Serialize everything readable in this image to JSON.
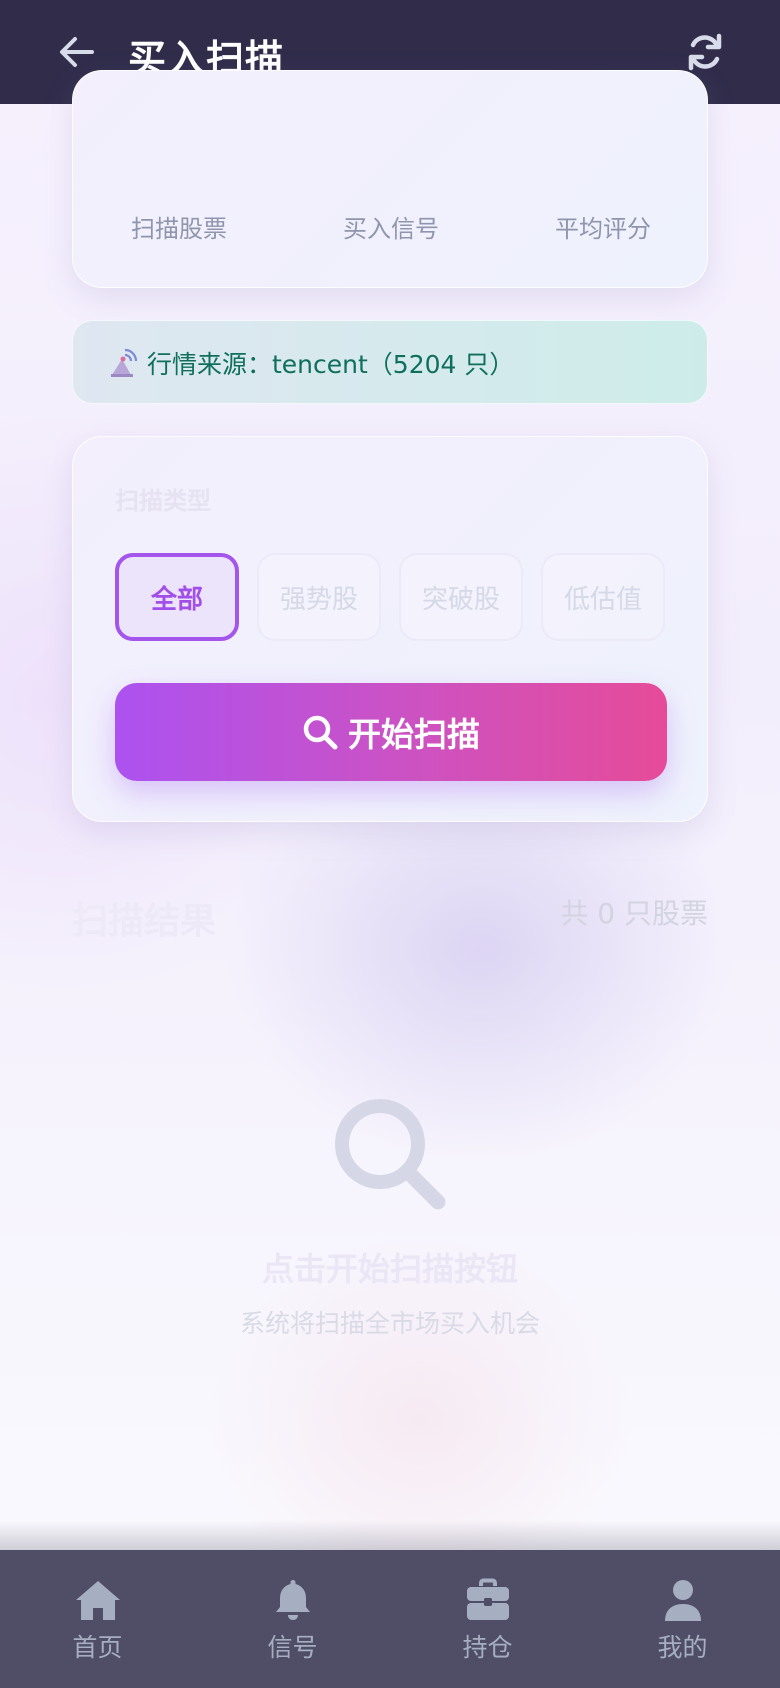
{
  "header": {
    "title": "买入扫描",
    "back_icon": "arrow-left-icon",
    "refresh_icon": "refresh-icon"
  },
  "stats": {
    "labels": [
      "扫描股票",
      "买入信号",
      "平均评分"
    ]
  },
  "source": {
    "icon": "antenna-icon",
    "text": "行情来源：tencent（5204 只）"
  },
  "scan": {
    "section_label": "扫描类型",
    "filters": [
      "全部",
      "强势股",
      "突破股",
      "低估值"
    ],
    "active_filter": "全部",
    "start_button": "开始扫描"
  },
  "results": {
    "title": "扫描结果",
    "count": "共 0 只股票",
    "empty_title": "点击开始扫描按钮",
    "empty_sub": "系统将扫描全市场买入机会"
  },
  "nav": {
    "items": [
      {
        "label": "首页",
        "icon": "home-icon"
      },
      {
        "label": "信号",
        "icon": "bell-icon"
      },
      {
        "label": "持仓",
        "icon": "briefcase-icon"
      },
      {
        "label": "我的",
        "icon": "user-icon"
      }
    ]
  },
  "colors": {
    "header_bg": "#302c4a",
    "accent": "#a455eb",
    "button_start": "#ac52f0",
    "button_end": "#e64b98",
    "source_text": "#0f6f5c",
    "nav_bg": "#504e66"
  }
}
